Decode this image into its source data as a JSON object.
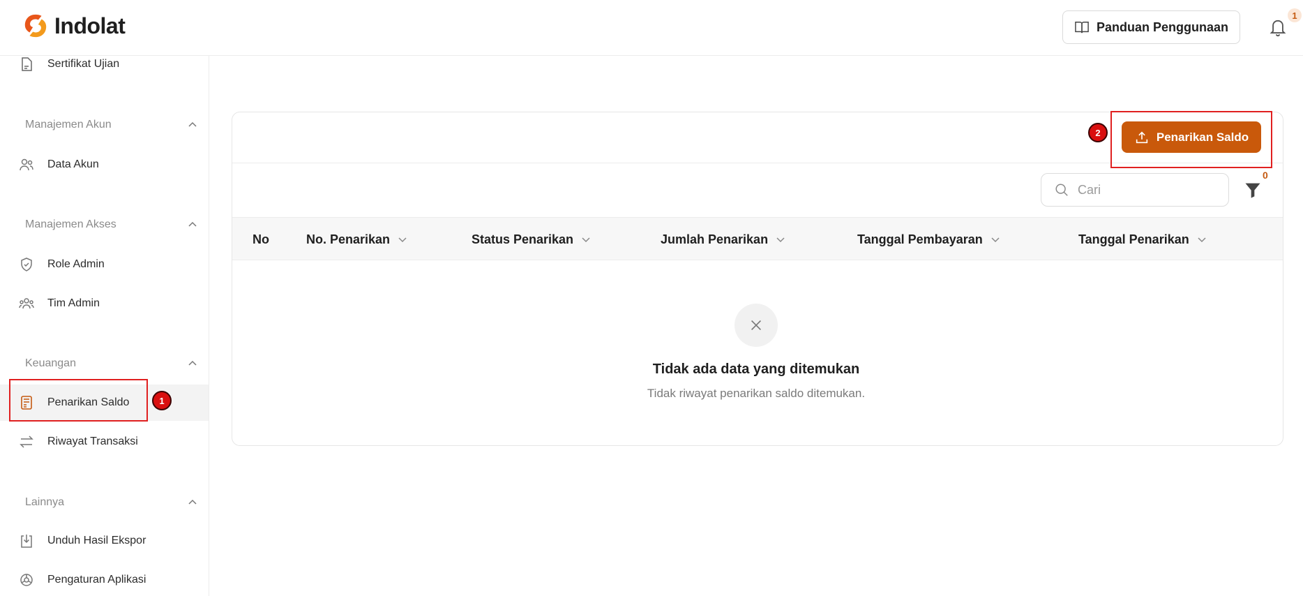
{
  "app": {
    "brand": "Indolat"
  },
  "header": {
    "guide_label": "Panduan Penggunaan",
    "notification_count": "1"
  },
  "sidebar": {
    "top_item": "Sertifikat Ujian",
    "sections": [
      {
        "title": "Manajemen Akun",
        "items": [
          "Data Akun"
        ]
      },
      {
        "title": "Manajemen Akses",
        "items": [
          "Role Admin",
          "Tim Admin"
        ]
      },
      {
        "title": "Keuangan",
        "items": [
          "Penarikan Saldo",
          "Riwayat Transaksi"
        ]
      },
      {
        "title": "Lainnya",
        "items": [
          "Unduh Hasil Ekspor",
          "Pengaturan Aplikasi"
        ]
      }
    ]
  },
  "annotations": {
    "step1": "1",
    "step2": "2"
  },
  "main": {
    "withdraw_button": "Penarikan Saldo",
    "search_placeholder": "Cari",
    "filter_count": "0",
    "columns": [
      "No",
      "No. Penarikan",
      "Status Penarikan",
      "Jumlah Penarikan",
      "Tanggal Pembayaran",
      "Tanggal Penarikan"
    ],
    "empty_title": "Tidak ada data yang ditemukan",
    "empty_subtitle": "Tidak riwayat penarikan saldo ditemukan."
  },
  "colors": {
    "brand": "#c9590b",
    "annotation": "#e02020"
  }
}
